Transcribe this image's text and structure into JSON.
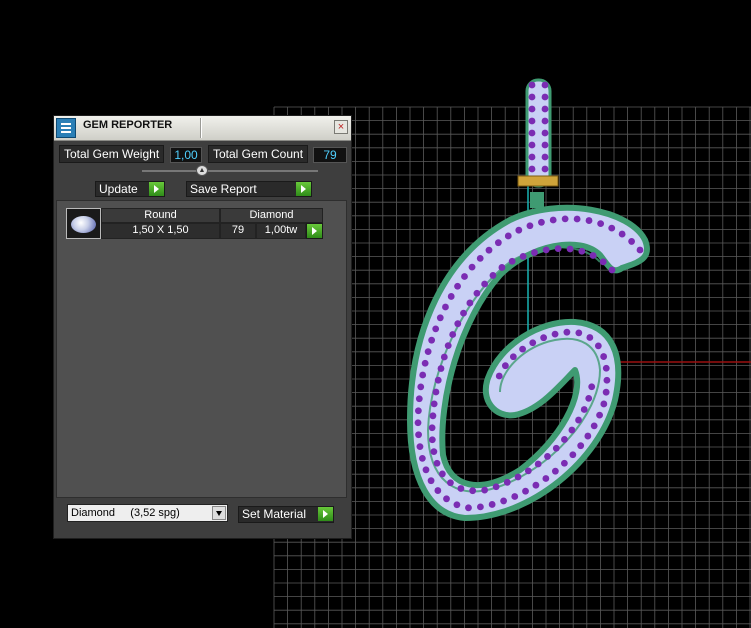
{
  "window": {
    "title": "GEM REPORTER",
    "close_symbol": "×"
  },
  "summary": {
    "weight_label": "Total Gem Weight",
    "weight_value": "1,00",
    "count_label": "Total Gem Count",
    "count_value": "79"
  },
  "buttons": {
    "update": "Update",
    "save_report": "Save Report",
    "set_material": "Set Material"
  },
  "gem_table": {
    "headers": [
      "Round",
      "Diamond"
    ],
    "rows": [
      {
        "size": "1,50 X 1,50",
        "count": "79",
        "weight": "1,00tw"
      }
    ]
  },
  "material": {
    "selected": "Diamond     (3,52 spg)"
  },
  "icons": {
    "app": "gem-reporter-app-icon",
    "close": "close-icon",
    "thumb": "round-gem-thumbnail",
    "arrow": "green-play-arrow-icon",
    "dropdown": "chevron-down-icon"
  },
  "colors": {
    "value_text": "#4fd0ff",
    "gem_fill": "#c9d1f5",
    "prong": "#7b2cb3",
    "rail": "#3f9b72",
    "grid": "#5a5a5a",
    "axis_x": "#9a1010",
    "axis_y": "#19b3b3",
    "accent_green": "#49a82a"
  }
}
